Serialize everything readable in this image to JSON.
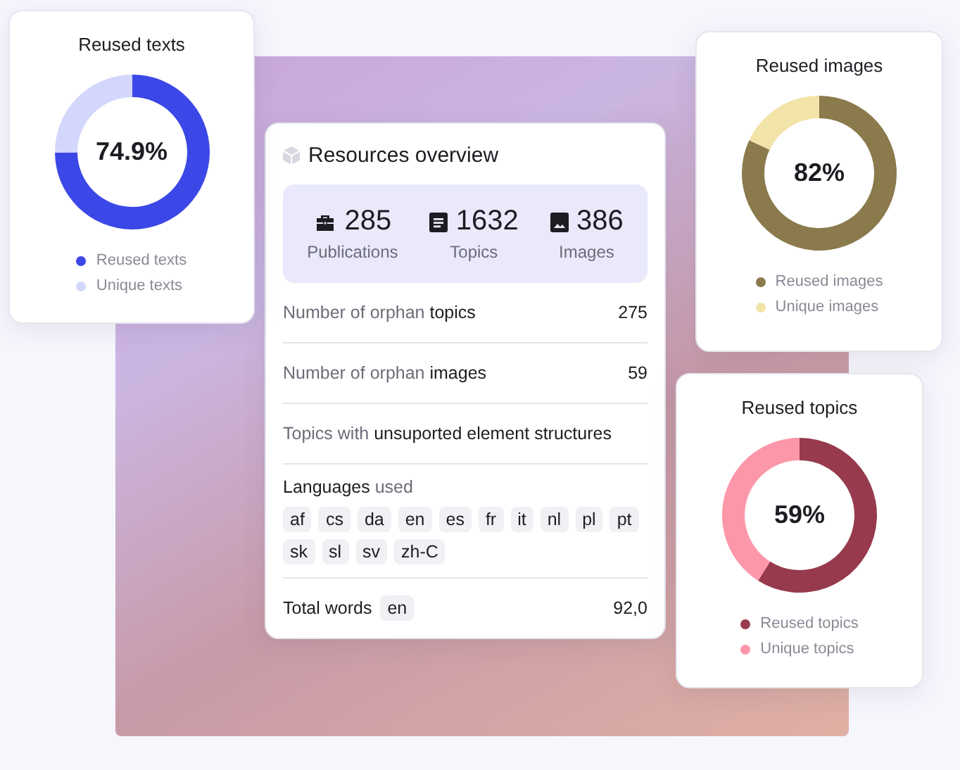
{
  "reused_texts_card": {
    "title": "Reused texts",
    "center_label": "74.9%",
    "chart_data": {
      "type": "donut",
      "categories": [
        "Reused texts",
        "Unique texts"
      ],
      "values": [
        74.9,
        25.1
      ]
    },
    "legend": [
      {
        "color": "#3b47e6"
      },
      {
        "color": "#d3d7fb"
      }
    ]
  },
  "resources_card": {
    "title": "Resources overview",
    "stats": [
      {
        "kind": "publications",
        "value": "285",
        "label": "Publications"
      },
      {
        "kind": "topics",
        "value": "1632",
        "label": "Topics"
      },
      {
        "kind": "images",
        "value": "386",
        "label": "Images"
      }
    ],
    "rows": [
      {
        "kind": "stat",
        "label": "Number of orphan **topics**",
        "value": "275"
      },
      {
        "kind": "stat",
        "label": "Number of orphan **images**",
        "value": "59"
      },
      {
        "kind": "stat",
        "label": "Topics with **unsuported element structures**"
      },
      {
        "kind": "languages",
        "label": "**Languages** used",
        "chips": [
          "af",
          "cs",
          "da",
          "en",
          "es",
          "fr",
          "it",
          "nl",
          "pl",
          "pt",
          "sk",
          "sl",
          "sv",
          "zh-C"
        ]
      },
      {
        "kind": "total",
        "label": "Total words",
        "chips": [
          "en"
        ],
        "value": "92,0"
      }
    ]
  },
  "reused_images_card": {
    "title": "Reused images",
    "center_label": "82%",
    "chart_data": {
      "type": "donut",
      "categories": [
        "Reused images",
        "Unique images"
      ],
      "values": [
        82,
        18
      ]
    },
    "legend": [
      {
        "color": "#8a7a4c"
      },
      {
        "color": "#f2e3a8"
      }
    ]
  },
  "reused_topics_card": {
    "title": "Reused topics",
    "center_label": "59%",
    "chart_data": {
      "type": "donut",
      "categories": [
        "Reused topics",
        "Unique topics"
      ],
      "values": [
        59,
        41
      ]
    },
    "legend": [
      {
        "color": "#973a4d"
      },
      {
        "color": "#fc97a9"
      }
    ]
  }
}
